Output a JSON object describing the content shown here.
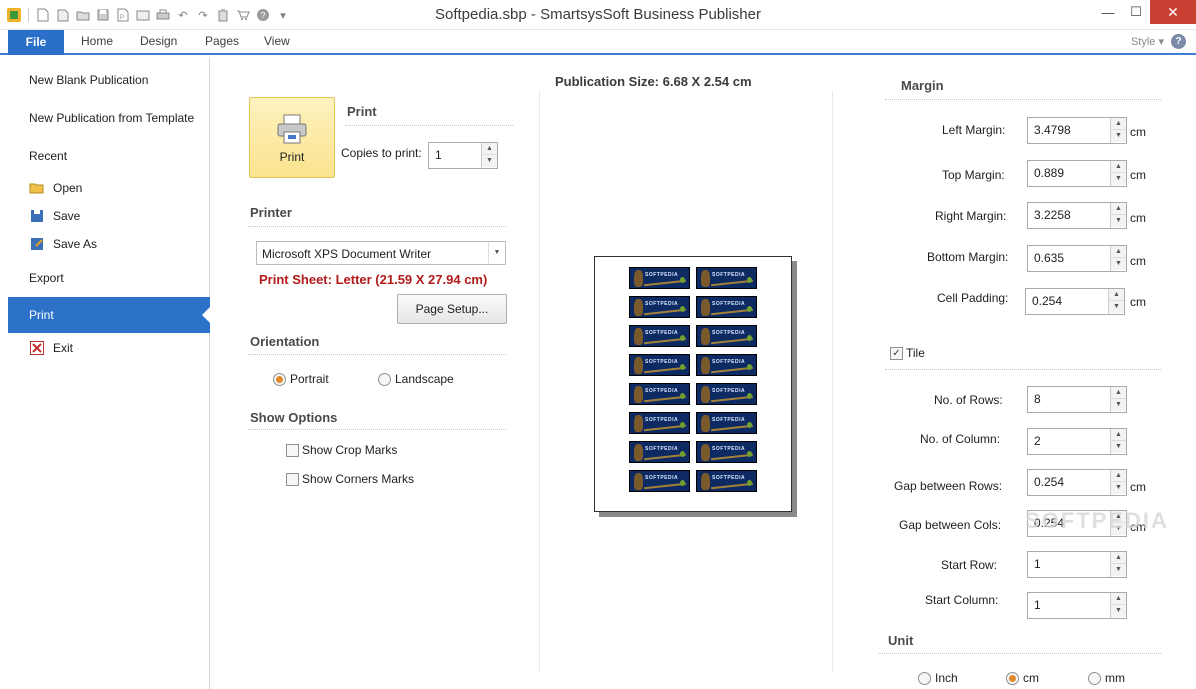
{
  "window": {
    "title": "Softpedia.sbp - SmartsysSoft Business Publisher",
    "controls": {
      "minimize": "—",
      "maximize": "☐",
      "close": "✕"
    },
    "quick_access_icons": [
      "app-icon",
      "new-icon",
      "new-template-icon",
      "open-icon",
      "save-icon",
      "export-pdf-icon",
      "export-image-icon",
      "print-preview-icon",
      "print-icon",
      "undo-icon",
      "redo-icon",
      "paste-icon",
      "cart-icon",
      "help-icon",
      "customize-icon"
    ]
  },
  "ribbon": {
    "tabs": [
      "File",
      "Home",
      "Design",
      "Pages",
      "View"
    ],
    "style_label": "Style",
    "help_label": "?"
  },
  "backstage": {
    "items": {
      "new_blank": "New Blank Publication",
      "new_template": "New Publication from Template",
      "recent": "Recent",
      "open": "Open",
      "save": "Save",
      "save_as": "Save As",
      "export": "Export",
      "print": "Print",
      "exit": "Exit"
    }
  },
  "print_panel": {
    "print_button": "Print",
    "print_heading": "Print",
    "copies_label": "Copies to print:",
    "copies_value": "1",
    "printer_heading": "Printer",
    "printer_value": "Microsoft XPS Document Writer",
    "print_sheet": "Print Sheet: Letter (21.59 X 27.94 cm)",
    "page_setup_button": "Page Setup...",
    "orientation_heading": "Orientation",
    "orientation_options": [
      "Portrait",
      "Landscape"
    ],
    "orientation_selected": "Portrait",
    "show_options_heading": "Show Options",
    "show_crop_marks": "Show Crop Marks",
    "show_corner_marks": "Show Corners Marks"
  },
  "preview": {
    "publication_size": "Publication Size: 6.68 X 2.54 cm",
    "tile_text": "SOFTPEDIA"
  },
  "margin_panel": {
    "margin_heading": "Margin",
    "fields": {
      "left_margin": {
        "label": "Left Margin:",
        "value": "3.4798",
        "unit": "cm"
      },
      "top_margin": {
        "label": "Top Margin:",
        "value": "0.889",
        "unit": "cm"
      },
      "right_margin": {
        "label": "Right Margin:",
        "value": "3.2258",
        "unit": "cm"
      },
      "bottom_margin": {
        "label": "Bottom Margin:",
        "value": "0.635",
        "unit": "cm"
      },
      "cell_padding": {
        "label": "Cell Padding:",
        "value": "0.254",
        "unit": "cm"
      },
      "rows": {
        "label": "No. of Rows:",
        "value": "8"
      },
      "columns": {
        "label": "No. of Column:",
        "value": "2"
      },
      "gap_rows": {
        "label": "Gap between Rows:",
        "value": "0.254",
        "unit": "cm"
      },
      "gap_cols": {
        "label": "Gap between Cols:",
        "value": "0.254",
        "unit": "cm"
      },
      "start_row": {
        "label": "Start Row:",
        "value": "1"
      },
      "start_column": {
        "label": "Start Column:",
        "value": "1"
      }
    },
    "tile_label": "Tile",
    "tile_checked": true,
    "unit_heading": "Unit",
    "unit_options": [
      "Inch",
      "cm",
      "mm"
    ],
    "unit_selected": "cm"
  },
  "watermark": "SOFTPEDIA",
  "colors": {
    "accent": "#2c72c9",
    "print_sheet_text": "#b21b1b",
    "close_button": "#c84031",
    "print_button_bg": "#fbe38e"
  }
}
